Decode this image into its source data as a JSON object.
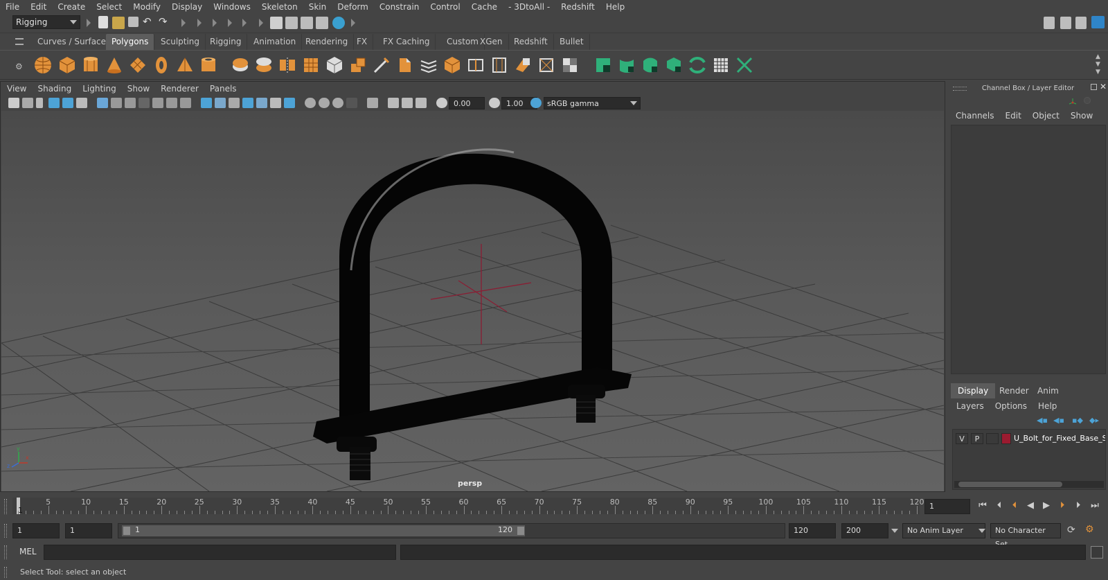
{
  "menubar": {
    "items": [
      "File",
      "Edit",
      "Create",
      "Select",
      "Modify",
      "Display",
      "Windows",
      "Skeleton",
      "Skin",
      "Deform",
      "Constrain",
      "Control",
      "Cache",
      "- 3DtoAll -",
      "Redshift",
      "Help"
    ]
  },
  "statusline": {
    "menuset": "Rigging"
  },
  "shelf": {
    "tabs": [
      "Curves / Surfaces",
      "Polygons",
      "Sculpting",
      "Rigging",
      "Animation",
      "Rendering",
      "FX",
      "FX Caching",
      "Custom",
      "XGen",
      "Redshift",
      "Bullet"
    ],
    "active_tab": "Polygons"
  },
  "viewport": {
    "menu": [
      "View",
      "Shading",
      "Lighting",
      "Show",
      "Renderer",
      "Panels"
    ],
    "exposure": "0.00",
    "gamma": "1.00",
    "colorspace": "sRGB gamma",
    "camera_label": "persp",
    "object": "U-bolt with base plate"
  },
  "right_panel": {
    "title": "Channel Box / Layer Editor",
    "channel_tabs": [
      "Channels",
      "Edit",
      "Object",
      "Show"
    ],
    "layer_tabs": [
      "Display",
      "Render",
      "Anim"
    ],
    "layer_active_tab": "Display",
    "layer_menu": [
      "Layers",
      "Options",
      "Help"
    ],
    "layers": [
      {
        "v": "V",
        "p": "P",
        "color": "#9b1b30",
        "name": "U_Bolt_for_Fixed_Base_S"
      }
    ]
  },
  "timeline": {
    "current_frame_marker": "1",
    "ticks": [
      "5",
      "10",
      "15",
      "20",
      "25",
      "30",
      "35",
      "40",
      "45",
      "50",
      "55",
      "60",
      "65",
      "70",
      "75",
      "80",
      "85",
      "90",
      "95",
      "100",
      "105",
      "110",
      "115",
      "120"
    ],
    "current_frame_field": "1"
  },
  "range": {
    "start": "1",
    "playback_start": "1",
    "slider_start": "1",
    "slider_end": "120",
    "playback_end": "120",
    "end": "200",
    "anim_layer": "No Anim Layer",
    "character_set": "No Character Set"
  },
  "command": {
    "label": "MEL"
  },
  "helpline": {
    "text": "Select Tool: select an object"
  }
}
